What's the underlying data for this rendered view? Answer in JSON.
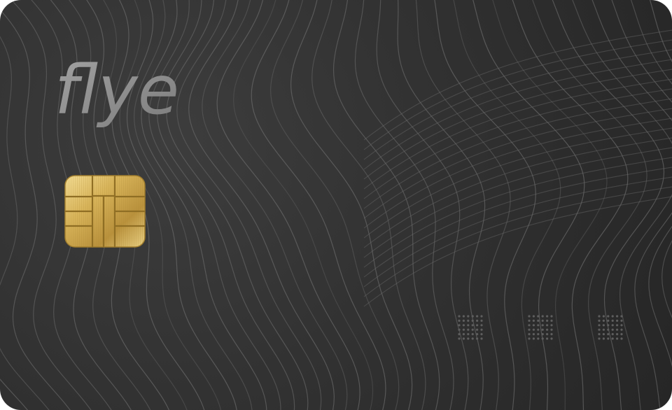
{
  "card": {
    "brand": "flye",
    "colors": {
      "background": "#303030",
      "lines": "#6a6a6a",
      "logo": "#8e8e8e",
      "chip_gold": "#d8b45a"
    }
  }
}
